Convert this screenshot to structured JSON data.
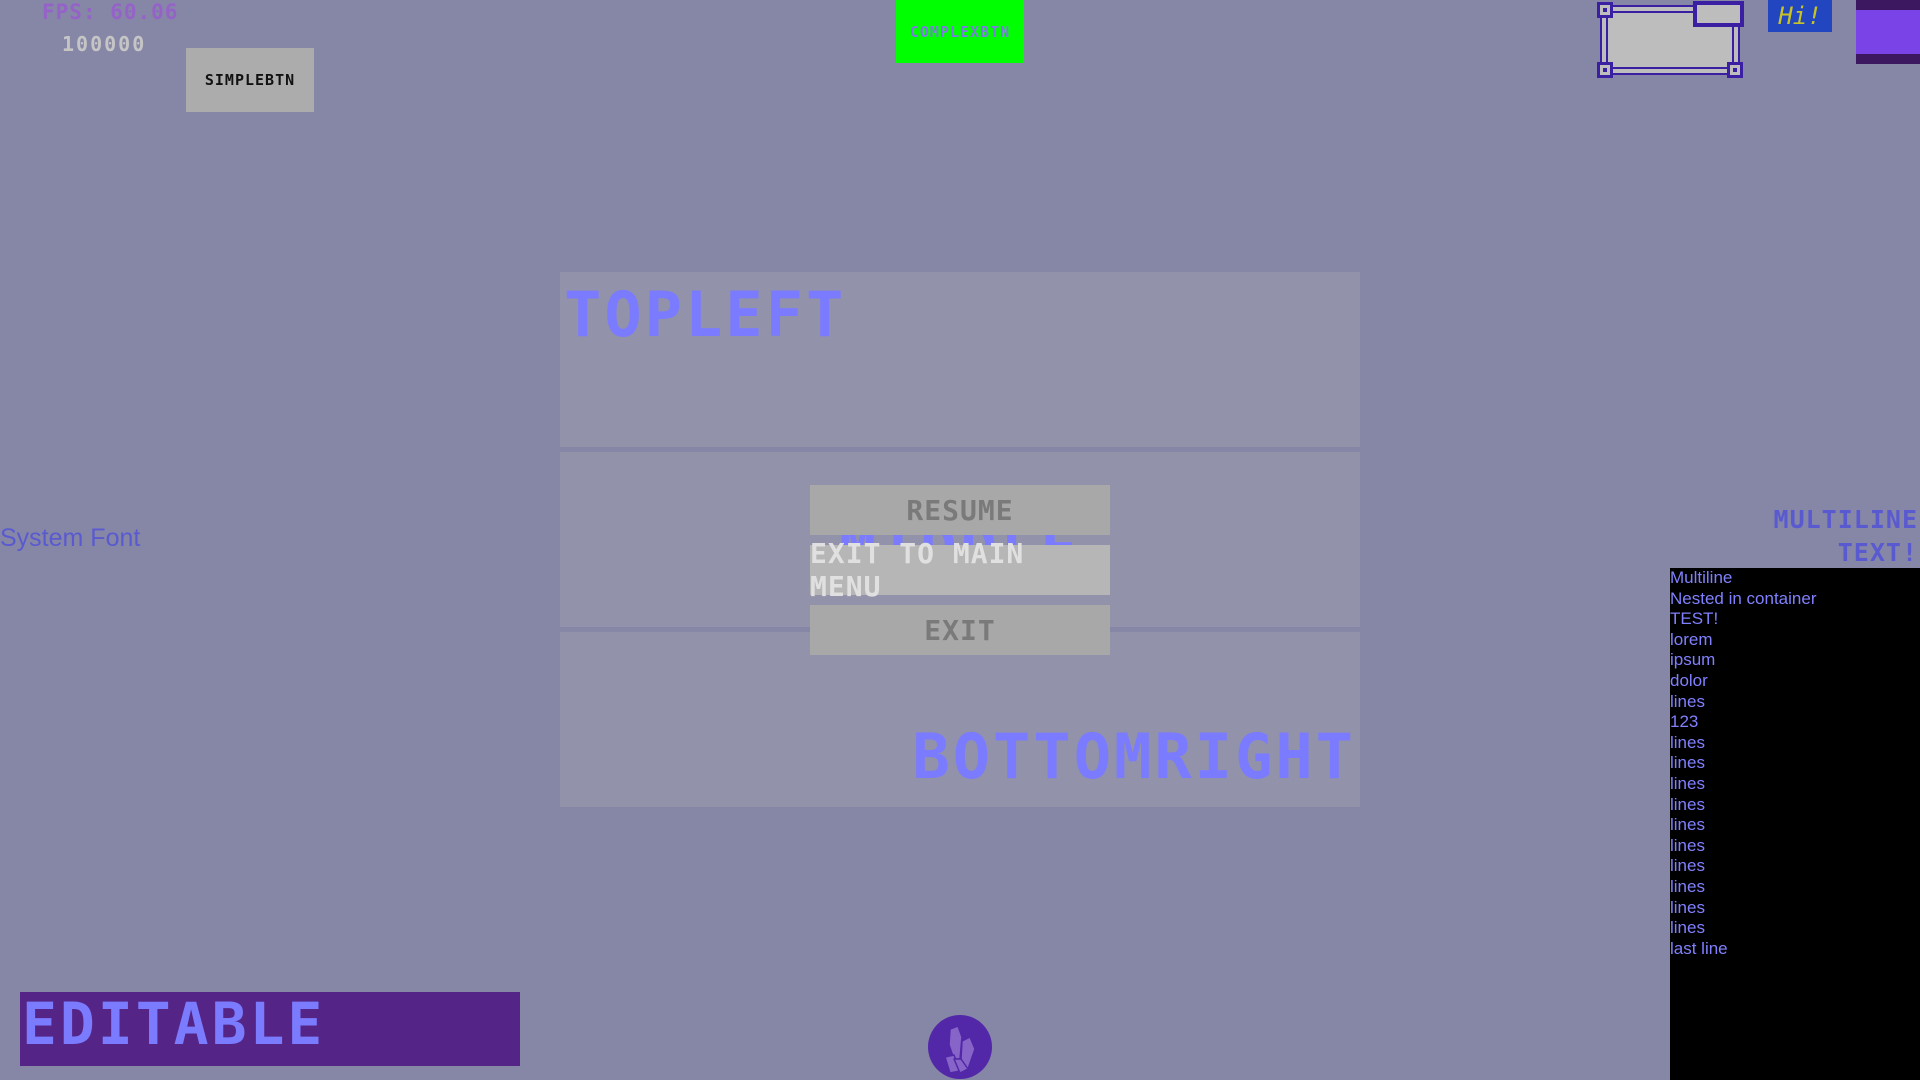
{
  "hud": {
    "fps_label": "FPS: 60.06",
    "counter": "100000"
  },
  "buttons": {
    "simple": "SIMPLEBTN",
    "complex": "COMPLEXBTN"
  },
  "top_right": {
    "hi_text": "Hi!",
    "colors": {
      "ninepatch_border": "#3b1fa3",
      "ninepatch_fill": "#bdbdbd",
      "hi_bg": "#2146c0",
      "hi_text": "#c9c425",
      "purple_block": "#7a43e8",
      "purple_block_band": "#3b1860"
    }
  },
  "panels": {
    "top_label": "TOPLEFT",
    "middle_label": "MIDDLE",
    "bottom_label": "BOTTOMRIGHT"
  },
  "pause_menu": {
    "items": [
      {
        "label": "RESUME",
        "state": "normal"
      },
      {
        "label": "EXIT TO MAIN MENU",
        "state": "hovered"
      },
      {
        "label": "EXIT",
        "state": "normal"
      }
    ]
  },
  "system_font_label": "System Font",
  "multiline_title": [
    "MULTILINE",
    "TEXT!"
  ],
  "nested_list": {
    "lines": [
      "Multiline",
      "Nested in container",
      "TEST!",
      "lorem",
      "ipsum",
      "dolor",
      "lines",
      "123",
      "lines",
      "lines",
      "lines",
      "lines",
      "lines",
      "lines",
      "lines",
      "lines",
      "lines",
      "lines",
      "last line"
    ]
  },
  "editable_field": {
    "value": "EDITABLE"
  },
  "logo": {
    "icon": "crystal-logo-icon",
    "color": "#5227a8"
  },
  "colors": {
    "background": "#8686a7",
    "panel": "#9292ab",
    "accent_text": "#7b7bff",
    "editable_bg": "#542586",
    "complex_btn_bg": "#00ff00"
  }
}
